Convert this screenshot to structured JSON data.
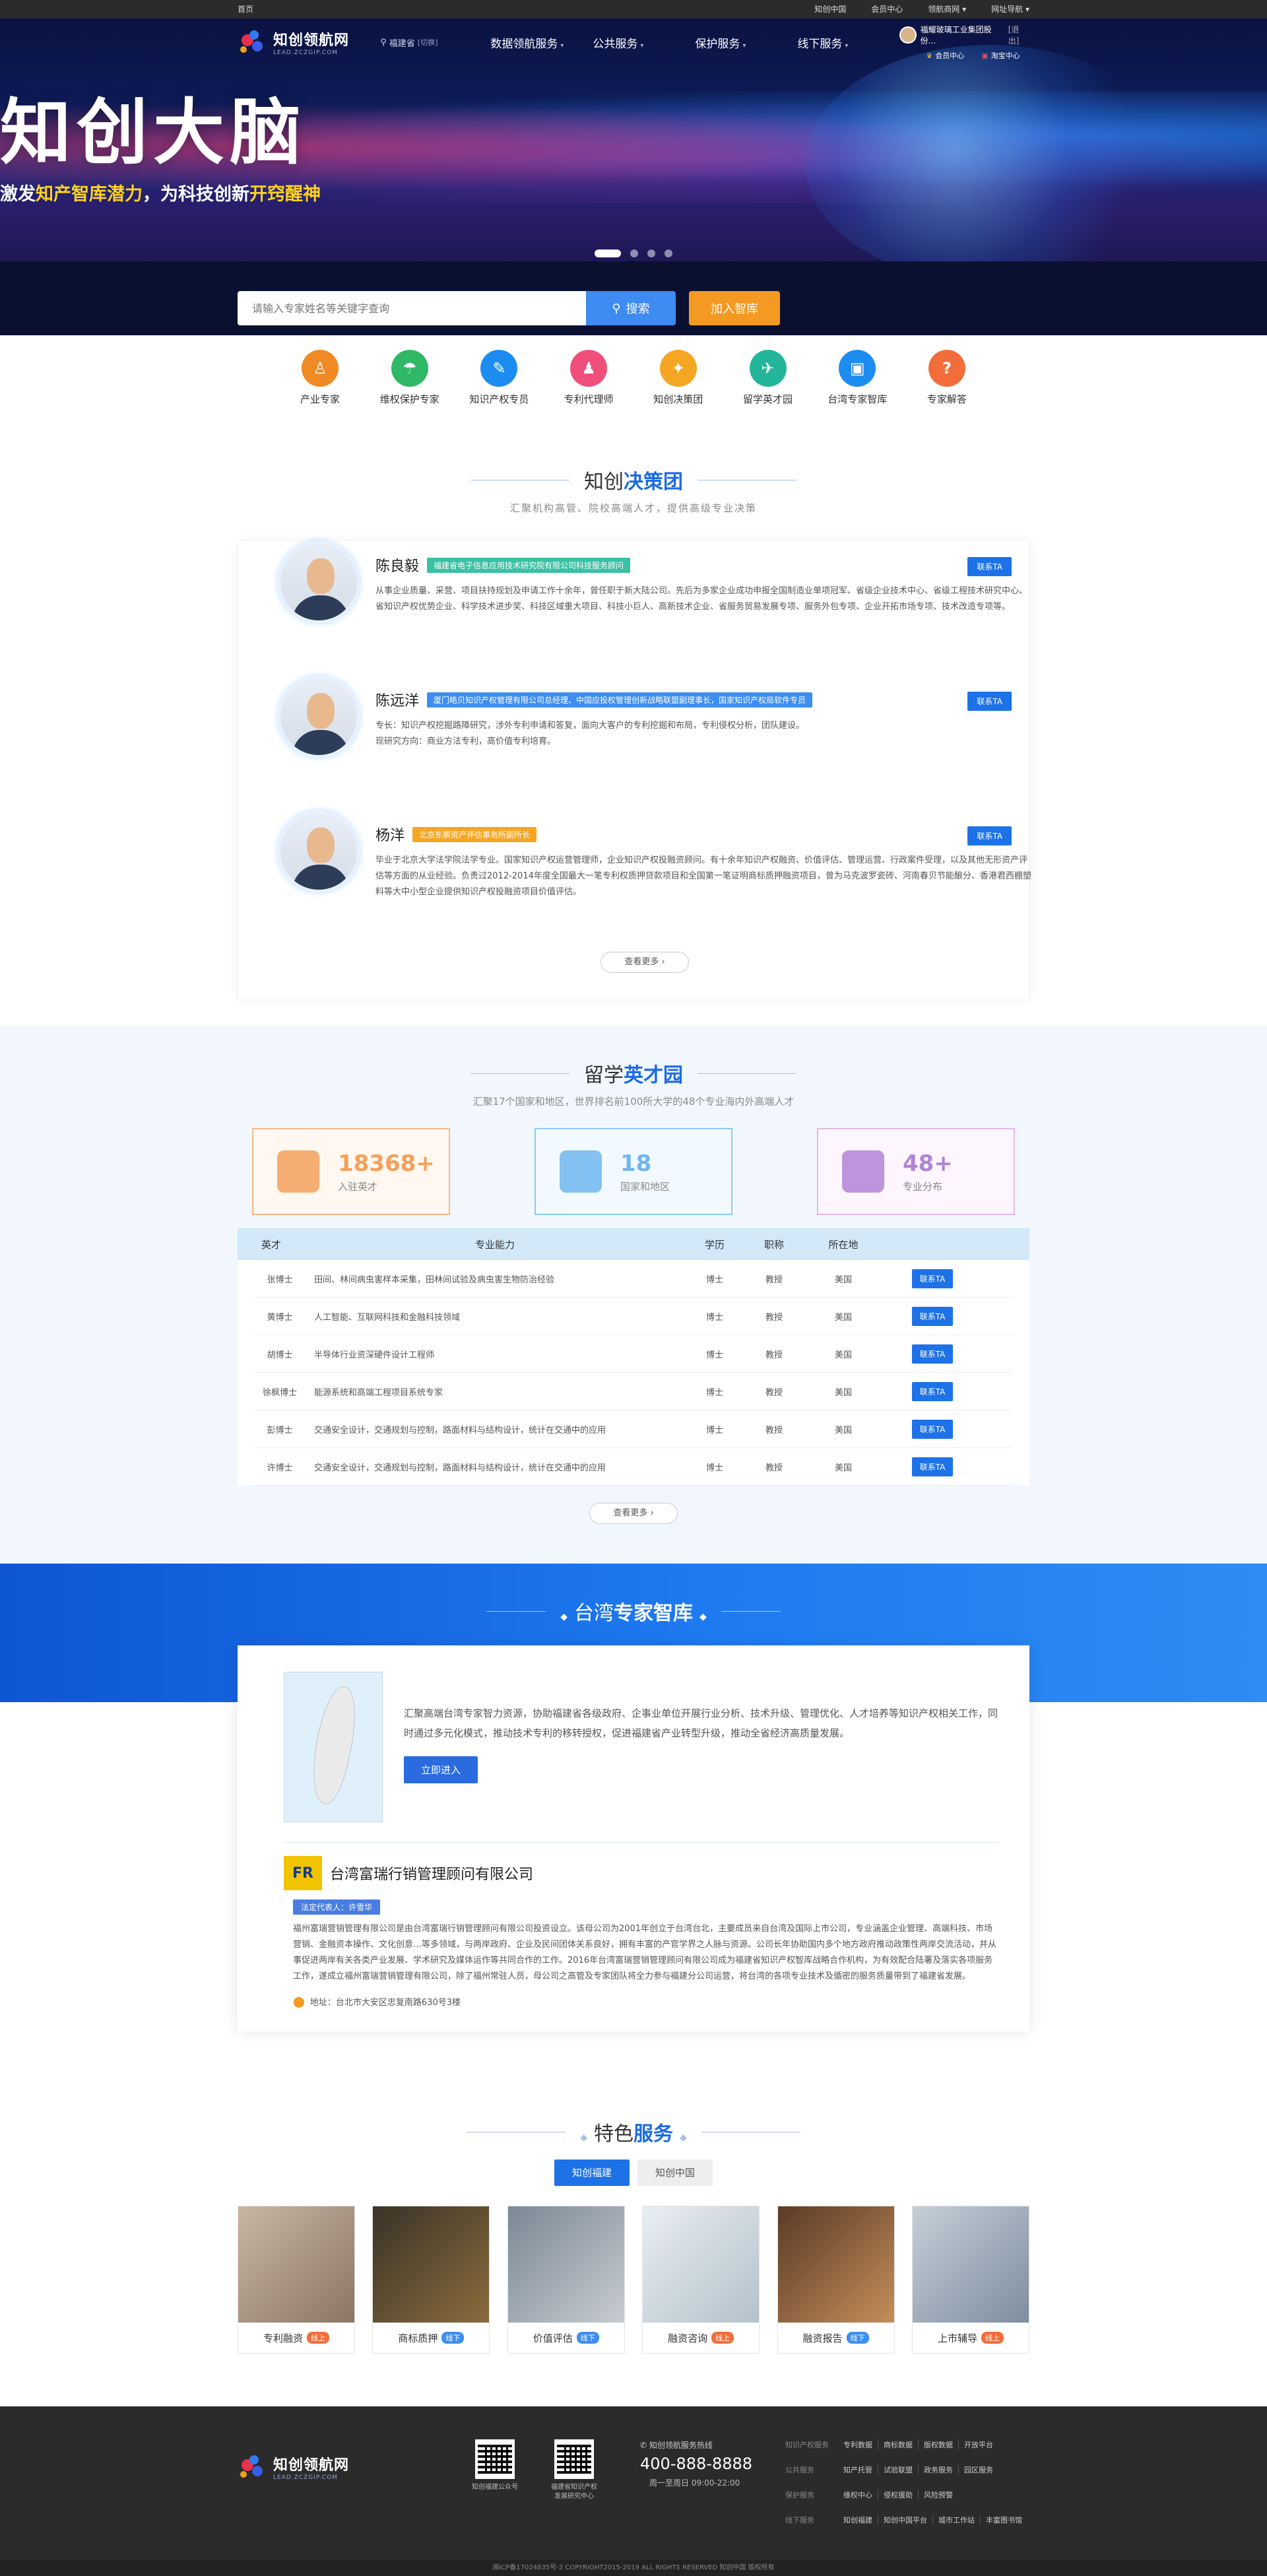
{
  "topbar": {
    "home": "首页",
    "links": [
      "知创中国",
      "会员中心",
      "领航商网",
      "网址导航"
    ]
  },
  "header": {
    "logo_title": "知创领航网",
    "logo_sub": "LEAD.ZCZGIP.COM",
    "city": "福建省",
    "city_switch": "[切换]",
    "nav": [
      "数据领航服务",
      "公共服务",
      "保护服务",
      "线下服务"
    ],
    "user_name": "福耀玻璃工业集团股份...",
    "user_exit": "[退出]",
    "member": "会员中心",
    "mall": "淘宝中心"
  },
  "banner": {
    "title": "知创大脑",
    "subtitle_a": "激发",
    "subtitle_b": "知产智库潜力",
    "subtitle_c": "，为科技创新",
    "subtitle_d": "开窍醒神"
  },
  "search": {
    "placeholder": "请输入专家姓名等关键字查询",
    "button": "搜索",
    "join": "加入智库"
  },
  "categories": [
    {
      "label": "产业专家",
      "icon": "industry-expert-icon",
      "color": "#f08a24",
      "glyph": "♙"
    },
    {
      "label": "维权保护专家",
      "icon": "umbrella-icon",
      "color": "#2fb866",
      "glyph": "☂"
    },
    {
      "label": "知识产权专员",
      "icon": "ip-specialist-icon",
      "color": "#1d8cf0",
      "glyph": "✎"
    },
    {
      "label": "专利代理师",
      "icon": "patent-agent-icon",
      "color": "#ef4f7a",
      "glyph": "♟"
    },
    {
      "label": "知创决策团",
      "icon": "bulb-icon",
      "color": "#f5a623",
      "glyph": "✦"
    },
    {
      "label": "留学英才园",
      "icon": "overseas-icon",
      "color": "#23b59a",
      "glyph": "✈"
    },
    {
      "label": "台湾专家智库",
      "icon": "taiwan-icon",
      "color": "#1d8cf0",
      "glyph": "▣"
    },
    {
      "label": "专家解答",
      "icon": "answer-icon",
      "color": "#f26d3a",
      "glyph": "?"
    }
  ],
  "decision": {
    "title_a": "知创",
    "title_b": "决策团",
    "subtitle": "汇聚机构高管、院校高端人才，提供高级专业决策",
    "contact": "联系TA",
    "more": "查看更多",
    "experts": [
      {
        "name": "陈良毅",
        "tag": "福建省电子信息应用技术研究院有限公司科技服务顾问",
        "tag_color": "#3bc0a3",
        "desc": "从事企业质量、采营、项目扶持规划及申请工作十余年，曾任职于新大陆公司。先后为多家企业成功申报全国制造业单项冠军、省级企业技术中心、省级工程技术研究中心、省知识产权优势企业、科学技术进步奖、科技区域重大项目、科技小巨人、高新技术企业、省服务贸易发展专项、服务外包专项、企业开拓市场专项、技术改造专项等。"
      },
      {
        "name": "陈远洋",
        "tag": "厦门皓贝知识产权管理有限公司总经理、中国应投权管理创新战略联盟副理事长，国家知识产权局软件专员",
        "tag_color": "#3d8ef0",
        "desc": "专长：知识产权挖掘路障研究，涉外专利申请和答复，面向大客户的专利挖掘和布局，专利侵权分析，团队建设。\n现研究方向：商业方法专利，高价值专利培育。"
      },
      {
        "name": "杨洋",
        "tag": "北京东鹏资产评估事务所副所长",
        "tag_color": "#f5a623",
        "desc": "毕业于北京大学法学院法学专业。国家知识产权运营管理师，企业知识产权投融资顾问。有十余年知识产权融资、价值评估、管理运营、行政案件受理，以及其他无形资产评估等方面的从业经验。负责过2012-2014年度全国最大一笔专利权质押贷款项目和全国第一笔证明商标质押融资项目，曾为马克波罗瓷砖、河南春贝节能酿分、香港君西棚塑料等大中小型企业提供知识产权投融资项目价值评估。"
      }
    ]
  },
  "overseas": {
    "title_a": "留学",
    "title_b": "英才园",
    "subtitle": "汇聚17个国家和地区，世界排名前100所大学的48个专业海内外高端人才",
    "stats": [
      {
        "num": "18368+",
        "label": "入驻英才",
        "color": "#f5a05a",
        "border": "#f6b98a",
        "bg": "#fff8f1"
      },
      {
        "num": "18",
        "label": "国家和地区",
        "color": "#6fb6f0",
        "border": "#8ccaf2",
        "bg": "#f3faff"
      },
      {
        "num": "48+",
        "label": "专业分布",
        "color": "#b084d6",
        "border": "#e3b8e8",
        "bg": "#fdf6fe"
      }
    ],
    "headers": [
      "英才",
      "专业能力",
      "学历",
      "职称",
      "所在地"
    ],
    "contact": "联系TA",
    "more": "查看更多",
    "rows": [
      [
        "张博士",
        "田间、林间病虫害样本采集，田林间试验及病虫害生物防治经验",
        "博士",
        "教授",
        "美国"
      ],
      [
        "黄博士",
        "人工智能、互联网科技和金融科技领域",
        "博士",
        "教授",
        "美国"
      ],
      [
        "胡博士",
        "半导体行业资深硬件设计工程师",
        "博士",
        "教授",
        "美国"
      ],
      [
        "徐枫博士",
        "能源系统和高端工程项目系统专家",
        "博士",
        "教授",
        "美国"
      ],
      [
        "彭博士",
        "交通安全设计，交通规划与控制，路面材料与结构设计，统计在交通中的应用",
        "博士",
        "教授",
        "美国"
      ],
      [
        "许博士",
        "交通安全设计，交通规划与控制，路面材料与结构设计，统计在交通中的应用",
        "博士",
        "教授",
        "美国"
      ]
    ]
  },
  "taiwan": {
    "title_a": "台湾",
    "title_b": "专家智库",
    "intro": "汇聚高端台湾专家智力资源，协助福建省各级政府、企事业单位开展行业分析、技术升级、管理优化、人才培养等知识产权相关工作，同时通过多元化模式，推动技术专利的移转授权，促进福建省产业转型升级，推动全省经济高质量发展。",
    "enter": "立即进入",
    "company": "台湾富瑞行销管理顾问有限公司",
    "logo_text": "FR",
    "legal": "法定代表人：许雪华",
    "company_desc": "福州富瑞营销管理有限公司是由台湾富瑞行销管理顾问有限公司投资设立。该母公司为2001年创立于台湾台北，主要成员来自台湾及国际上市公司，专业涵盖企业管理、高端科技、市场营销、金融资本操作、文化创意…等多领域，与两岸政府、企业及民间团体关系良好，拥有丰富的产官学界之人脉与资源。公司长年协助国内多个地方政府推动政策性两岸交流活动，并从事促进两岸有关各类产业发展、学术研究及媒体运作等共同合作的工作。2016年台湾富瑞营销管理顾问有限公司成为福建省知识产权智库战略合作机构，为有效配合陆署及落实各项服务工作，遂成立福州富瑞营销管理有限公司，除了福州常驻人员，母公司之高管及专家团队将全力参与福建分公司运营，将台湾的各项专业技术及循密的服务质量带到了福建省发展。",
    "address": "地址：台北市大安区忠复南路630号3楼"
  },
  "services": {
    "title_a": "特色",
    "title_b": "服务",
    "tabs": [
      "知创福建",
      "知创中国"
    ],
    "cards": [
      {
        "label": "专利融资",
        "badge": "线上",
        "badge_color": "#f26d3a"
      },
      {
        "label": "商标质押",
        "badge": "线下",
        "badge_color": "#3d8ef0"
      },
      {
        "label": "价值评估",
        "badge": "线下",
        "badge_color": "#3d8ef0"
      },
      {
        "label": "融资咨询",
        "badge": "线上",
        "badge_color": "#f26d3a"
      },
      {
        "label": "融资报告",
        "badge": "线下",
        "badge_color": "#3d8ef0"
      },
      {
        "label": "上市辅导",
        "badge": "线上",
        "badge_color": "#f26d3a"
      }
    ]
  },
  "footer": {
    "logo_title": "知创领航网",
    "logo_sub": "LEAD.ZCZGIP.COM",
    "qr1": "知创福建公众号",
    "qr2_a": "福建省知识产权",
    "qr2_b": "发展研究中心",
    "hotline_label": "知创领航服务热线",
    "hotline": "400-888-8888",
    "hours": "周一至周日 09:00-22:00",
    "rows": [
      {
        "k": "知识产权服务",
        "v": [
          "专利数据",
          "商标数据",
          "版权数据",
          "开放平台"
        ]
      },
      {
        "k": "公共服务",
        "v": [
          "知产托管",
          "试验联盟",
          "政务服务",
          "园区服务"
        ]
      },
      {
        "k": "保护服务",
        "v": [
          "维权中心",
          "侵权援助",
          "风险预警"
        ]
      },
      {
        "k": "线下服务",
        "v": [
          "知创福建",
          "知创中国平台",
          "城市工作站",
          "丰富图书馆"
        ]
      }
    ],
    "copyright": "闽ICP备17024835号-2 COPYRIGHT2015-2019 ALL RIGHTS RESERVED 知创中国 版权所有"
  }
}
